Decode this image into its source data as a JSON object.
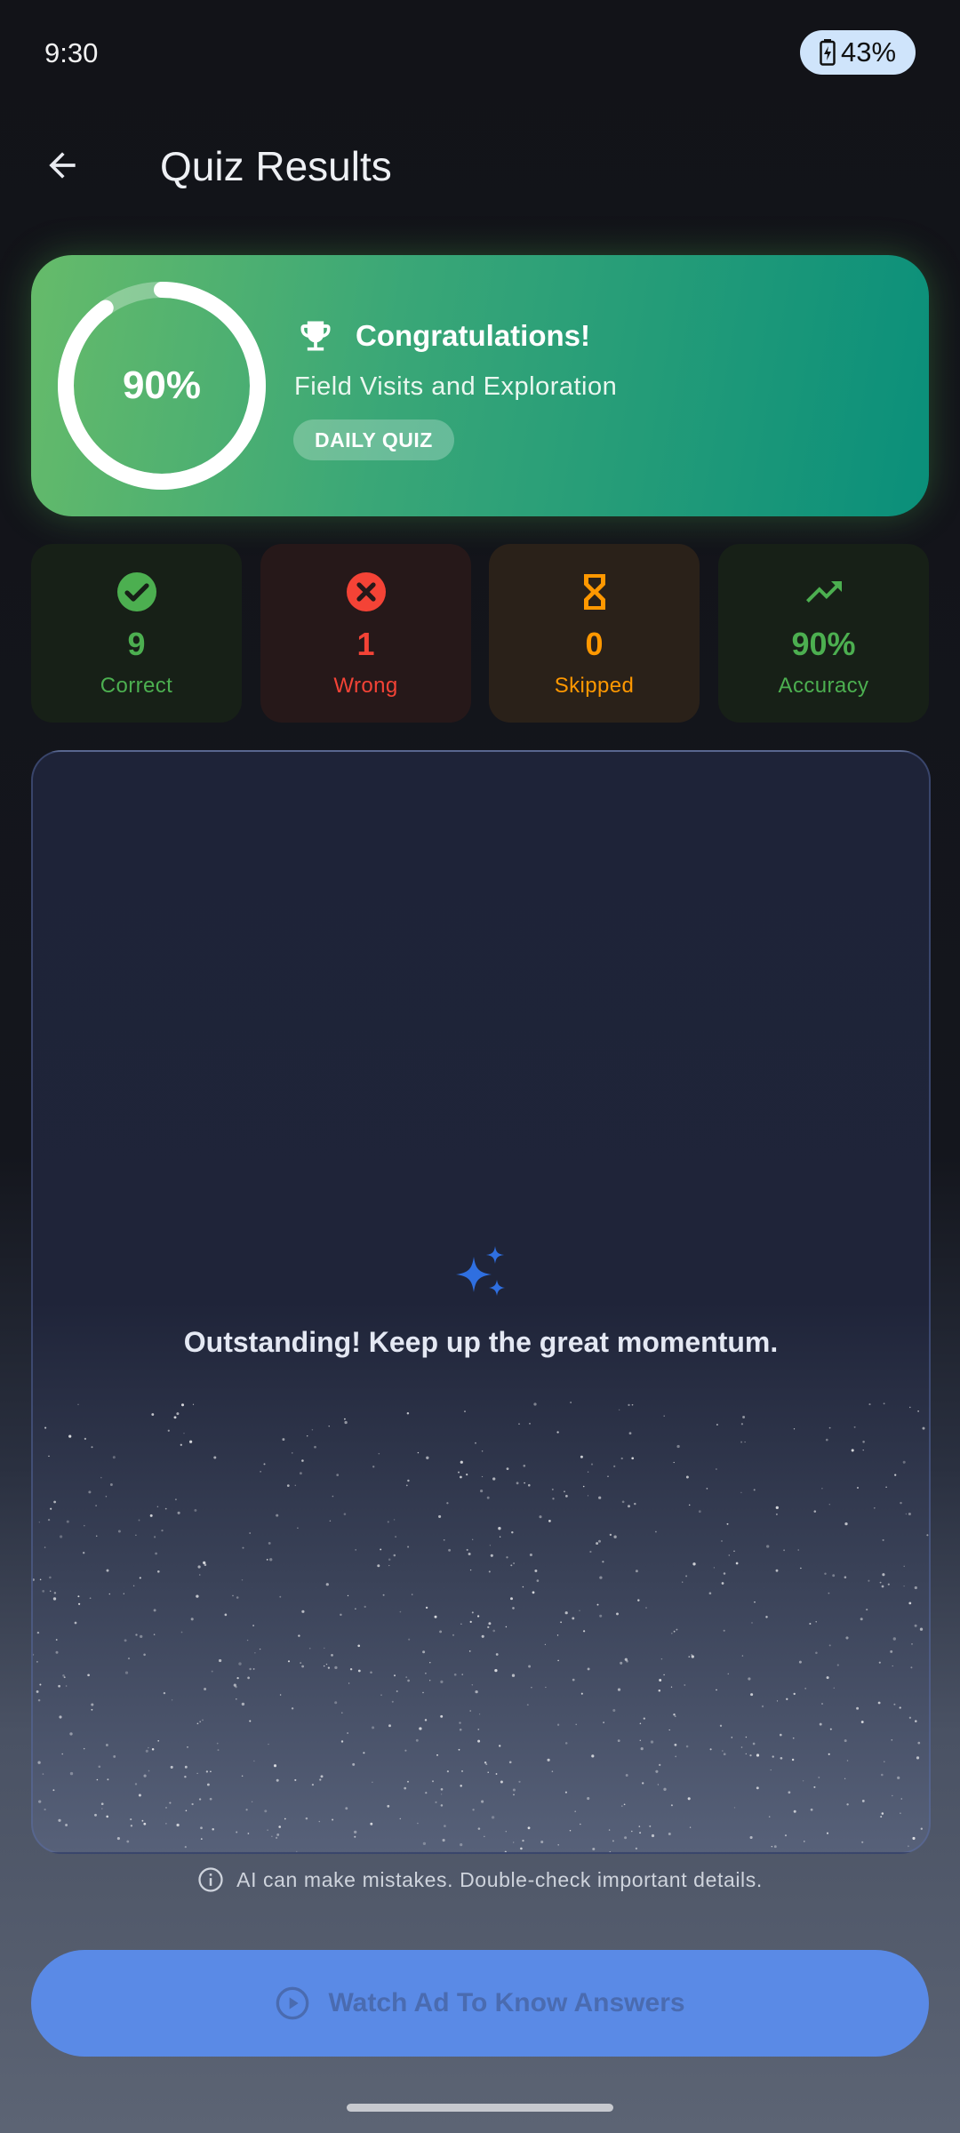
{
  "status_bar": {
    "time": "9:30",
    "battery": "43%"
  },
  "header": {
    "title": "Quiz Results"
  },
  "hero": {
    "score_percent": 90,
    "score_label": "90%",
    "congrats": "Congratulations!",
    "topic": "Field Visits and Exploration",
    "badge": "DAILY QUIZ"
  },
  "stats": [
    {
      "value": "9",
      "label": "Correct",
      "color": "#4caf50",
      "icon": "check-circle-icon"
    },
    {
      "value": "1",
      "label": "Wrong",
      "color": "#f44336",
      "icon": "close-circle-icon"
    },
    {
      "value": "0",
      "label": "Skipped",
      "color": "#ff9800",
      "icon": "hourglass-icon"
    },
    {
      "value": "90%",
      "label": "Accuracy",
      "color": "#4caf50",
      "icon": "trending-up-icon"
    }
  ],
  "ai_panel": {
    "message": "Outstanding! Keep up the great momentum.",
    "icon": "sparkle-icon",
    "icon_color": "#2f6fe0"
  },
  "disclaimer": "AI can make mistakes. Double-check important details.",
  "action_button": {
    "label": "Watch Ad To Know Answers",
    "icon": "play-circle-icon"
  },
  "colors": {
    "hero_start": "#66bb6a",
    "hero_end": "#0a8f7a",
    "button": "#5a8ae6"
  }
}
